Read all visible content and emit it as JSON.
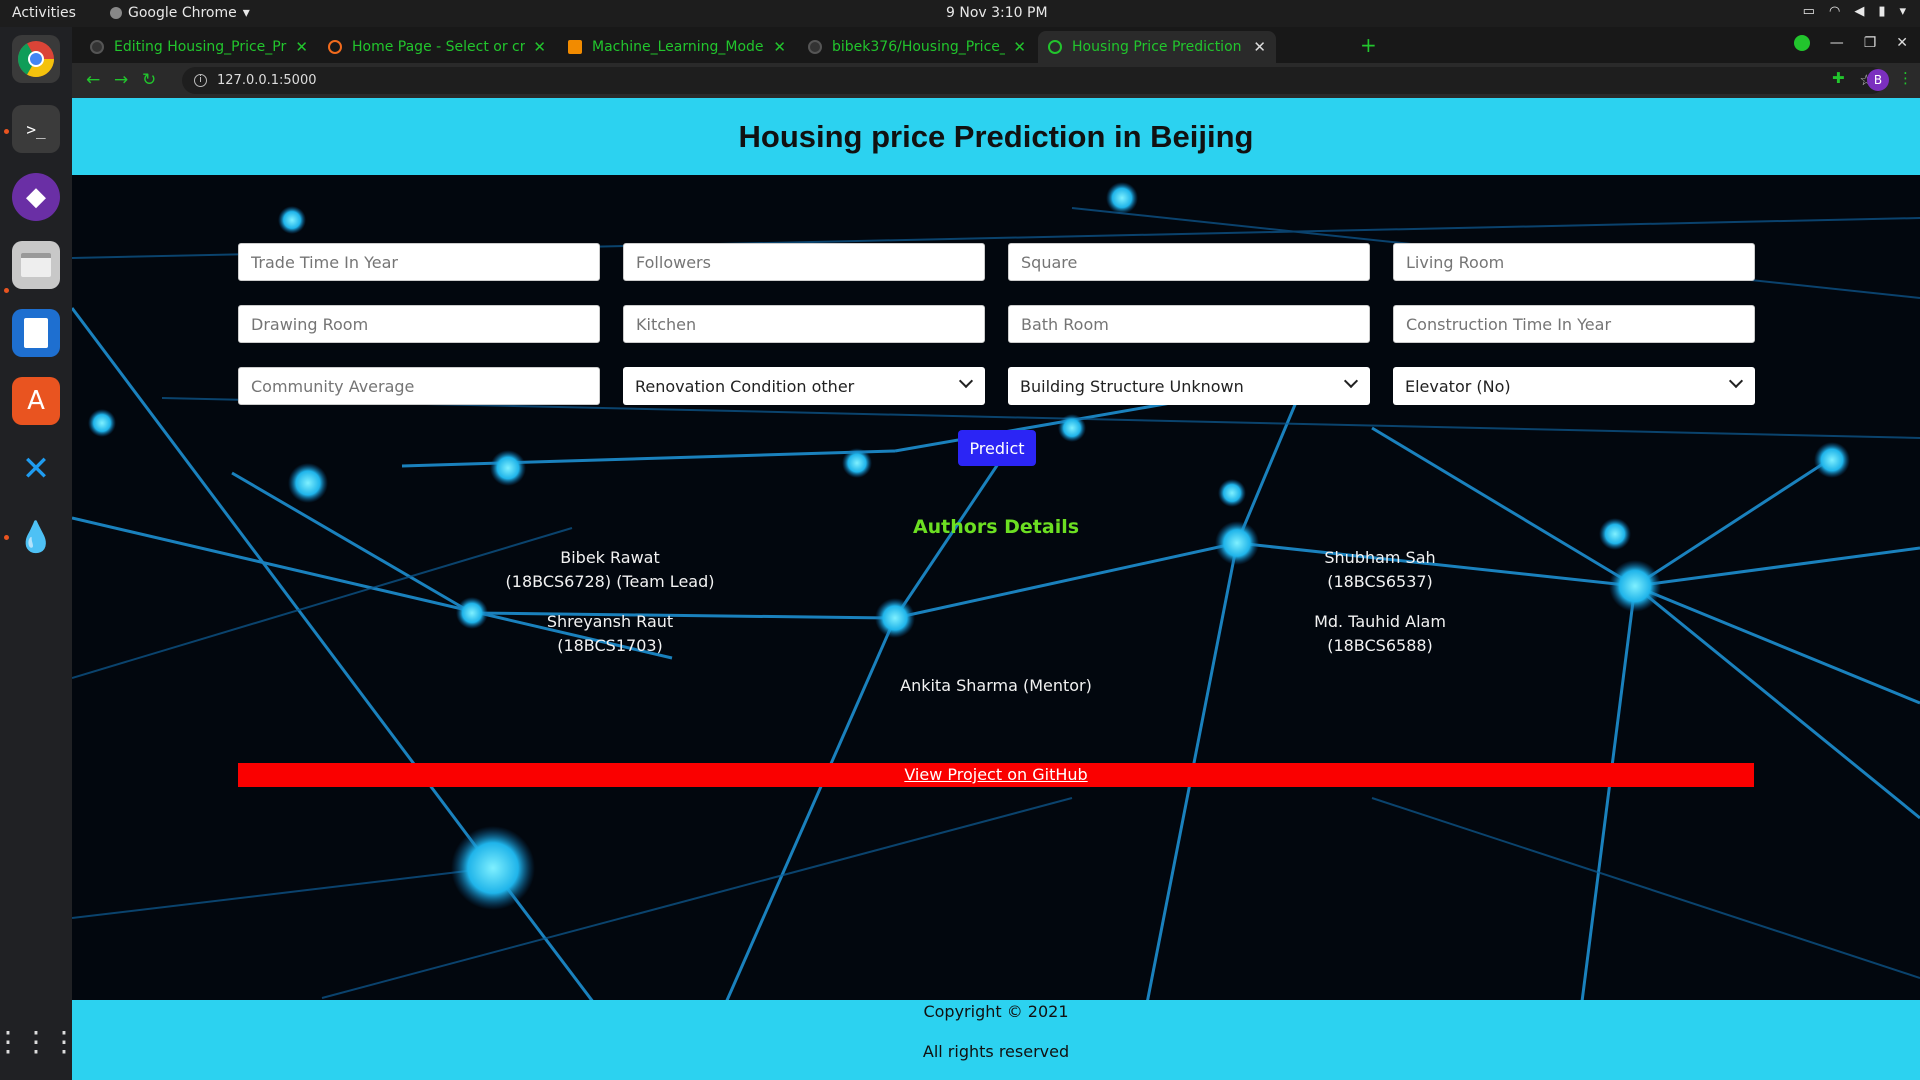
{
  "os": {
    "activities": "Activities",
    "app_name": "Google Chrome",
    "clock": "9 Nov  3:10 PM"
  },
  "browser": {
    "tabs": [
      {
        "label": "Editing Housing_Price_Pr"
      },
      {
        "label": "Home Page - Select or cre"
      },
      {
        "label": "Machine_Learning_Mode"
      },
      {
        "label": "bibek376/Housing_Price_"
      },
      {
        "label": "Housing Price Prediction"
      }
    ],
    "url": "127.0.0.1:5000",
    "avatar_letter": "B",
    "accent_color": "#22c52d"
  },
  "page": {
    "title": "Housing price Prediction in Beijing",
    "fields": [
      {
        "placeholder": "Trade Time In Year"
      },
      {
        "placeholder": "Followers"
      },
      {
        "placeholder": "Square"
      },
      {
        "placeholder": "Living Room"
      },
      {
        "placeholder": "Drawing Room"
      },
      {
        "placeholder": "Kitchen"
      },
      {
        "placeholder": "Bath Room"
      },
      {
        "placeholder": "Construction Time In Year"
      },
      {
        "placeholder": "Community Average"
      }
    ],
    "selects": [
      {
        "value": "Renovation Condition other"
      },
      {
        "value": "Building Structure Unknown"
      },
      {
        "value": "Elevator (No)"
      }
    ],
    "predict_label": "Predict",
    "authors_title": "Authors Details",
    "authors": {
      "a1_name": "Bibek Rawat",
      "a1_detail": "(18BCS6728) (Team Lead)",
      "a2_name": "Shreyansh Raut",
      "a2_detail": "(18BCS1703)",
      "a3_name": "Shubham Sah",
      "a3_detail": "(18BCS6537)",
      "a4_name": "Md. Tauhid Alam",
      "a4_detail": "(18BCS6588)",
      "mentor": "Ankita Sharma (Mentor)"
    },
    "github_link": "View Project on GitHub",
    "footer_copyright": "Copyright © 2021",
    "footer_rights": "All rights reserved",
    "colors": {
      "header_bg": "#2cd2f0",
      "predict_bg": "#2b25f5",
      "authors_title": "#6cdf22",
      "github_bar": "#fa0000"
    }
  }
}
